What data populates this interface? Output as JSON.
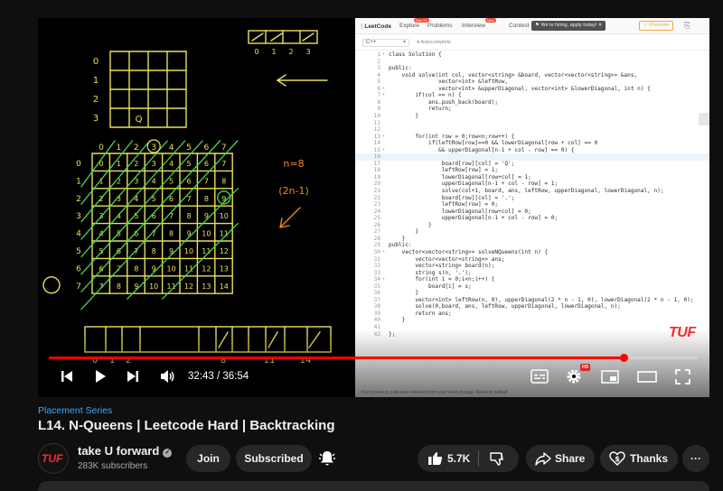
{
  "video": {
    "series": "Placement Series",
    "title": "L14. N-Queens | Leetcode Hard | Backtracking",
    "time_current": "32:43",
    "time_separator": " / ",
    "time_total": "36:54",
    "progress": 0.887,
    "watermark": "TUF",
    "hd_badge": "HD"
  },
  "channel": {
    "name": "take U forward",
    "subscribers": "283K subscribers",
    "avatar_text": "TUF",
    "join_label": "Join",
    "subscribed_label": "Subscribed"
  },
  "actions": {
    "likes": "5.7K",
    "share_label": "Share",
    "thanks_label": "Thanks",
    "more_label": "···"
  },
  "board": {
    "small_rows": [
      "0",
      "1",
      "2",
      "3"
    ],
    "small_q": "Q",
    "top_right_cols": [
      "0",
      "1",
      "2",
      "3"
    ],
    "n_label": "n=8",
    "formula": "(2n-1)",
    "big_col_header": [
      "0",
      "1",
      "2",
      "3",
      "4",
      "5",
      "6",
      "7"
    ],
    "big_rows": [
      [
        "0",
        "1",
        "2",
        "3",
        "4",
        "5",
        "6",
        "7"
      ],
      [
        "1",
        "2",
        "3",
        "4",
        "5",
        "6",
        "7",
        "8"
      ],
      [
        "2",
        "3",
        "4",
        "5",
        "6",
        "7",
        "8",
        "9"
      ],
      [
        "3",
        "4",
        "5",
        "6",
        "7",
        "8",
        "9",
        "10"
      ],
      [
        "4",
        "5",
        "6",
        "7",
        "8",
        "9",
        "10",
        "11"
      ],
      [
        "5",
        "6",
        "7",
        "8",
        "9",
        "10",
        "11",
        "12"
      ],
      [
        "6",
        "7",
        "8",
        "9",
        "10",
        "11",
        "12",
        "13"
      ],
      [
        "7",
        "8",
        "9",
        "10",
        "11",
        "12",
        "13",
        "14"
      ]
    ],
    "bottom_labels": [
      "0",
      "1",
      "2",
      "8",
      "11",
      "14"
    ]
  },
  "leetcode": {
    "logo": "LeetCode",
    "nav": [
      "Explore",
      "Problems",
      "Interview",
      "Contest"
    ],
    "nav_badges": [
      "Dec 21",
      "New"
    ],
    "hiring": "We're hiring, apply today!",
    "premium": "Premium",
    "language": "C++",
    "autocomplete": "Autocomplete",
    "footer": "Your previous code was restored from your local storage. Reset to default",
    "highlight_line": 16,
    "code": [
      {
        "n": "1",
        "f": "▾",
        "t": "class Solution {"
      },
      {
        "n": "2",
        "f": "",
        "t": ""
      },
      {
        "n": "3",
        "f": "",
        "t": "public:"
      },
      {
        "n": "4",
        "f": "",
        "t": "    void solve(int col, vector<string> &board, vector<vector<string>> &ans,"
      },
      {
        "n": "5",
        "f": "",
        "t": "               vector<int> &leftRow,"
      },
      {
        "n": "6",
        "f": "▾",
        "t": "               vector<int> &upperDiagonal, vector<int> &lowerDiagonal, int n) {"
      },
      {
        "n": "7",
        "f": "▾",
        "t": "        if(col == n) {"
      },
      {
        "n": "8",
        "f": "",
        "t": "            ans.push_back(board);"
      },
      {
        "n": "9",
        "f": "",
        "t": "            return;"
      },
      {
        "n": "10",
        "f": "",
        "t": "        }"
      },
      {
        "n": "11",
        "f": "",
        "t": ""
      },
      {
        "n": "12",
        "f": "",
        "t": ""
      },
      {
        "n": "13",
        "f": "▾",
        "t": "        for(int row = 0;row<n;row++) {"
      },
      {
        "n": "14",
        "f": "",
        "t": "            if(leftRow[row]==0 && lowerDiagonal[row + col] == 0"
      },
      {
        "n": "15",
        "f": "▾",
        "t": "               && upperDiagonal[n-1 + col - row] == 0) {"
      },
      {
        "n": "16",
        "f": "",
        "t": ""
      },
      {
        "n": "17",
        "f": "",
        "t": "                board[row][col] = 'Q';"
      },
      {
        "n": "18",
        "f": "",
        "t": "                leftRow[row] = 1;"
      },
      {
        "n": "19",
        "f": "",
        "t": "                lowerDiagonal[row+col] = 1;"
      },
      {
        "n": "20",
        "f": "",
        "t": "                upperDiagonal[n-1 + col - row] = 1;"
      },
      {
        "n": "21",
        "f": "",
        "t": "                solve(col+1, board, ans, leftRow, upperDiagonal, lowerDiagonal, n);"
      },
      {
        "n": "22",
        "f": "",
        "t": "                board[row][col] = '.';"
      },
      {
        "n": "23",
        "f": "",
        "t": "                leftRow[row] = 0;"
      },
      {
        "n": "24",
        "f": "",
        "t": "                lowerDiagonal[row+col] = 0;"
      },
      {
        "n": "25",
        "f": "",
        "t": "                upperDiagonal[n-1 + col - row] = 0;"
      },
      {
        "n": "26",
        "f": "",
        "t": "            }"
      },
      {
        "n": "27",
        "f": "",
        "t": "        }"
      },
      {
        "n": "28",
        "f": "",
        "t": "    }"
      },
      {
        "n": "29",
        "f": "",
        "t": "public:"
      },
      {
        "n": "30",
        "f": "▾",
        "t": "    vector<vector<string>> solveNQueens(int n) {"
      },
      {
        "n": "31",
        "f": "",
        "t": "        vector<vector<string>> ans;"
      },
      {
        "n": "32",
        "f": "",
        "t": "        vector<string> board(n);"
      },
      {
        "n": "33",
        "f": "",
        "t": "        string s(n, '.');"
      },
      {
        "n": "34",
        "f": "▾",
        "t": "        for(int i = 0;i<n;i++) {"
      },
      {
        "n": "35",
        "f": "",
        "t": "            board[i] = s;"
      },
      {
        "n": "36",
        "f": "",
        "t": "        }"
      },
      {
        "n": "37",
        "f": "",
        "t": "        vector<int> leftRow(n, 0), upperDiagonal(2 * n - 1, 0), lowerDiagonal(2 * n - 1, 0);"
      },
      {
        "n": "38",
        "f": "",
        "t": "        solve(0,board, ans, leftRow, upperDiagonal, lowerDiagonal, n);"
      },
      {
        "n": "39",
        "f": "",
        "t": "        return ans;"
      },
      {
        "n": "40",
        "f": "",
        "t": "    }"
      },
      {
        "n": "41",
        "f": "",
        "t": ""
      },
      {
        "n": "42",
        "f": "",
        "t": "};"
      }
    ]
  },
  "colors": {
    "ink": "#e8e05a",
    "ink_green": "#4fd64f",
    "ink_orange": "#f08a1c",
    "progress": "#ff0000",
    "link": "#3ea6ff"
  },
  "icons": [
    "prev-icon",
    "play-icon",
    "next-icon",
    "volume-icon",
    "chapters-icon",
    "settings-icon",
    "miniplayer-icon",
    "theater-icon",
    "fullscreen-icon",
    "verified-icon",
    "bell-icon",
    "like-icon",
    "dislike-icon",
    "share-icon",
    "thanks-icon"
  ]
}
